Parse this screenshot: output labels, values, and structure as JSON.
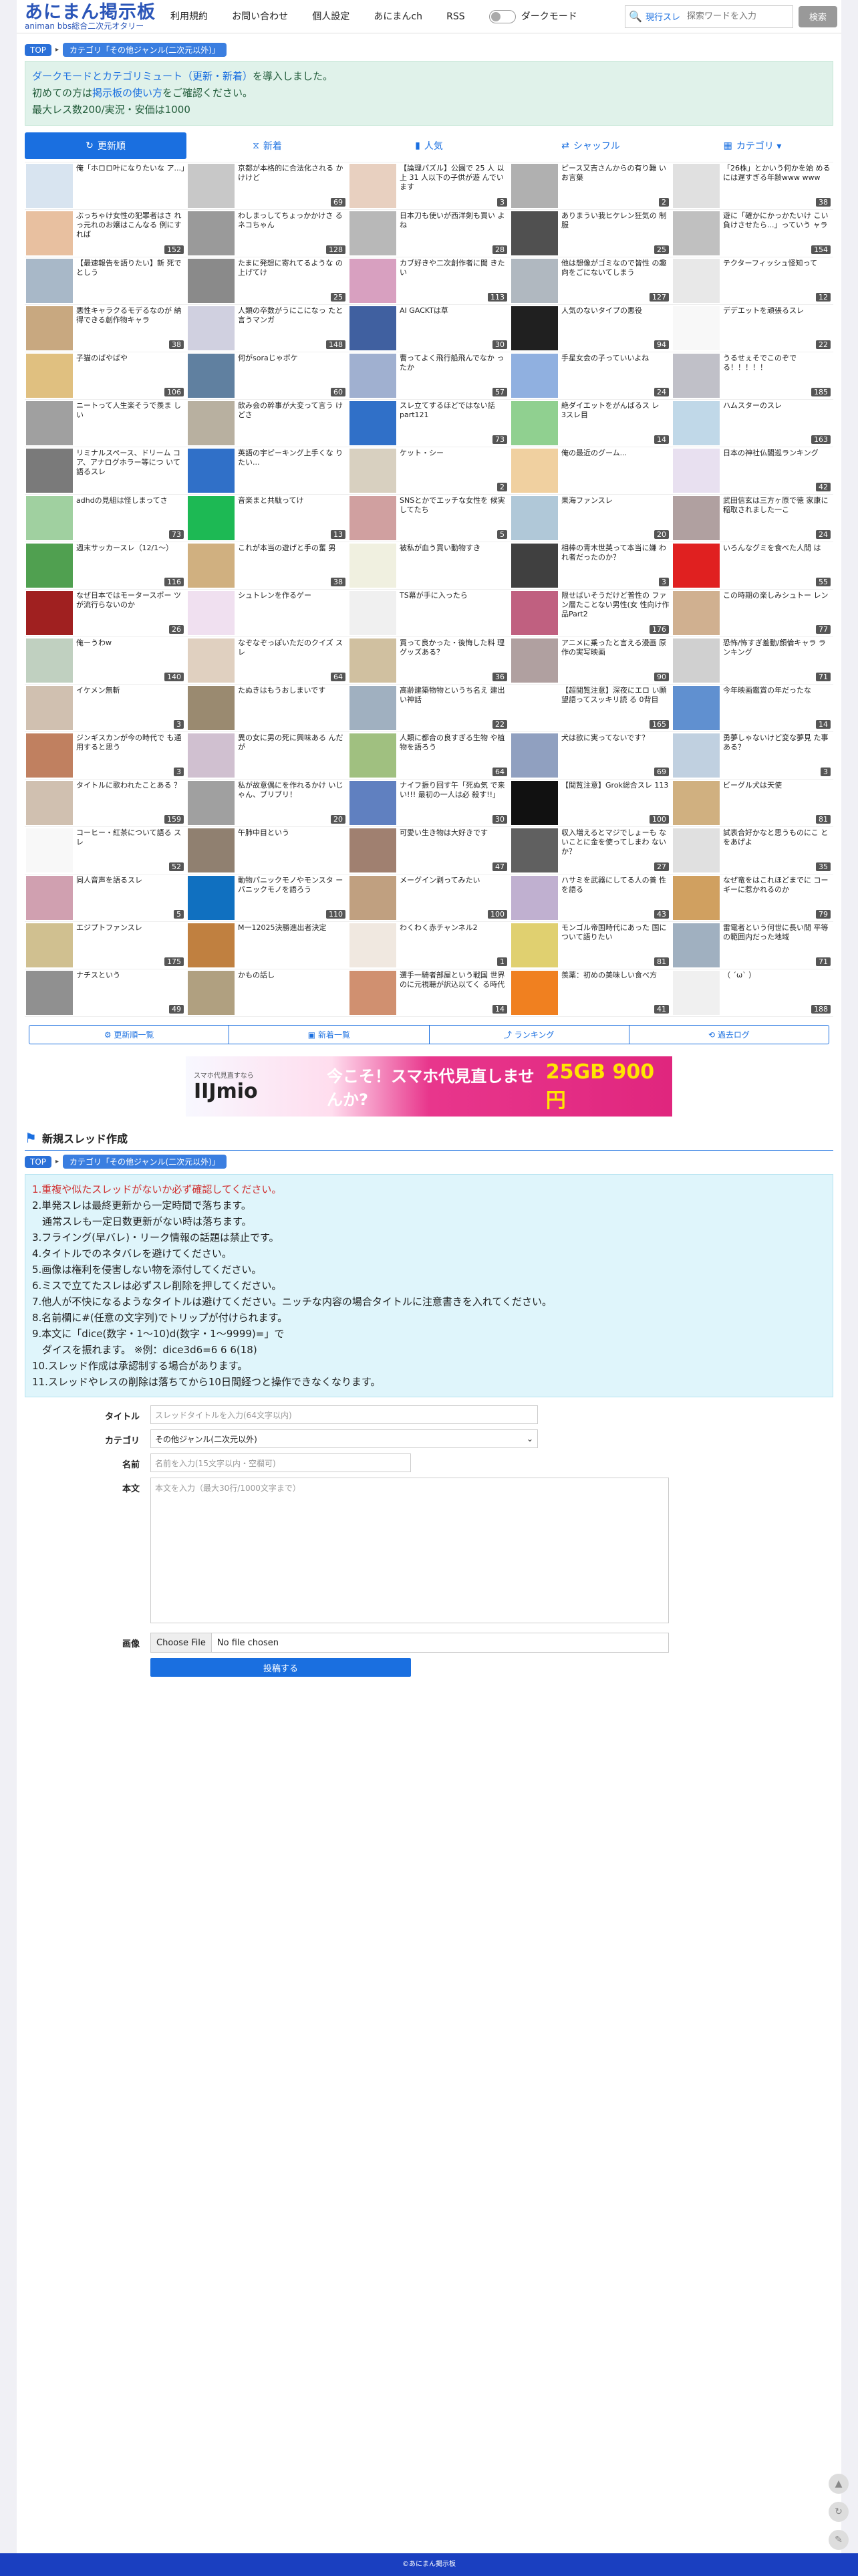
{
  "header": {
    "logo_title": "あにまん掲示板",
    "logo_sub": "animan bbs総合二次元オタリー",
    "nav": [
      "利用規約",
      "お問い合わせ",
      "個人設定",
      "あにまんch",
      "RSS"
    ],
    "dark_mode": "ダークモード",
    "search_scope": "現行スレ",
    "search_placeholder": "探索ワードを入力",
    "search_button": "検索"
  },
  "breadcrumb": {
    "top": "TOP",
    "category": "カテゴリ「その他ジャンル(二次元以外)」"
  },
  "notice": {
    "line1_link": "ダークモードとカテゴリミュート（更新・新着）",
    "line1_rest": "を導入しました。",
    "line2_pre": "初めての方は",
    "line2_link": "掲示板の使い方",
    "line2_post": "をご確認ください。",
    "line3": "最大レス数200/実況・安価は1000"
  },
  "tabs": [
    {
      "icon": "↻",
      "label": "更新順"
    },
    {
      "icon": "⧖",
      "label": "新着"
    },
    {
      "icon": "▮",
      "label": "人気"
    },
    {
      "icon": "⇄",
      "label": "シャッフル"
    },
    {
      "icon": "▦",
      "label": "カテゴリ ▾"
    }
  ],
  "threads": [
    {
      "t": "俺「ホロロ叶になりたいな ア...」",
      "c": "",
      "col": "#d8e4f0"
    },
    {
      "t": "京都が本格的に合法化される かけけど",
      "c": "69",
      "col": "#c8c8c8"
    },
    {
      "t": "【論理パズル】公園で 25 人 以上 31 人以下の子供が遊 んでいます",
      "c": "3",
      "col": "#e8d0c0"
    },
    {
      "t": "ピース又吉さんからの有り難 いお言葉",
      "c": "2",
      "col": "#b0b0b0"
    },
    {
      "t": "「26株」とかいう何かを始 めるには遅すぎる年齢www www",
      "c": "38",
      "col": "#e0e0e0"
    },
    {
      "t": "ぶっちゃけ女性の犯罪者はさ れっ元れのお嬢はこんなる 例にすれば",
      "c": "152",
      "col": "#e8c0a0"
    },
    {
      "t": "わしまっしてちょっかかけさ るネコちゃん",
      "c": "128",
      "col": "#9a9a9a"
    },
    {
      "t": "日本刀も使いが西洋剣も買い よね",
      "c": "28",
      "col": "#b8b8b8"
    },
    {
      "t": "ありまうい我ヒケレン狂気の 制服",
      "c": "25",
      "col": "#505050"
    },
    {
      "t": "遊に「確かにかっかたいけ こい負けさせたら...」っていう ャラ",
      "c": "154",
      "col": "#c0c0c0"
    },
    {
      "t": "【最速報告を語りたい】新 死でとしう",
      "c": "",
      "col": "#a8b8c8"
    },
    {
      "t": "たまに発想に寄れてるような の上げてけ",
      "c": "25",
      "col": "#8a8a8a"
    },
    {
      "t": "カブ好きや二次創作者に聞 きたい",
      "c": "113",
      "col": "#d8a0c0"
    },
    {
      "t": "他は想像がゴミなので皆性 の趣向をごにないてしまう",
      "c": "127",
      "col": "#b0b8c0"
    },
    {
      "t": "テクターフィッシュ怪知って",
      "c": "12",
      "col": "#e8e8e8"
    },
    {
      "t": "悪性キャラクるモデるなのが 納得できる創作物キャラ",
      "c": "38",
      "col": "#c8a880"
    },
    {
      "t": "人類の卒数がうにこになっ たと言うマンガ",
      "c": "148",
      "col": "#d0d0e0"
    },
    {
      "t": "AI GACKTは草",
      "c": "30",
      "col": "#4060a0"
    },
    {
      "t": "人気のないタイプの悪役",
      "c": "94",
      "col": "#202020"
    },
    {
      "t": "デデエットを頑張るスレ",
      "c": "22",
      "col": "#f8f8f8"
    },
    {
      "t": "子猫のばやばや",
      "c": "106",
      "col": "#e0c080"
    },
    {
      "t": "何がsoraじゃボケ",
      "c": "60",
      "col": "#6080a0"
    },
    {
      "t": "曹ってよく飛行船飛んでなか ったか",
      "c": "57",
      "col": "#a0b0d0"
    },
    {
      "t": "手星女会の子っていいよね",
      "c": "24",
      "col": "#90b0e0"
    },
    {
      "t": "うるせぇそでこのぞで る！！！！！",
      "c": "185",
      "col": "#c0c0c8"
    },
    {
      "t": "ニートって人生楽そうで羨ま しい",
      "c": "",
      "col": "#a0a0a0"
    },
    {
      "t": "飲み会の幹事が大変って言う けどさ",
      "c": "",
      "col": "#b8b0a0"
    },
    {
      "t": "スレ立てするほどではない話 part121",
      "c": "73",
      "col": "#3070c8"
    },
    {
      "t": "絶ダイエットをがんばるス レ　3スレ目",
      "c": "14",
      "col": "#90d090"
    },
    {
      "t": "ハムスターのスレ",
      "c": "163",
      "col": "#c0d8e8"
    },
    {
      "t": "リミナルスペース、ドリーム コア、アナログホラー等につ いて語るスレ",
      "c": "",
      "col": "#7a7a7a"
    },
    {
      "t": "英語の宇ピーキング上手くな りたい...",
      "c": "",
      "col": "#3070c8"
    },
    {
      "t": "ケット・シー",
      "c": "2",
      "col": "#d8d0c0"
    },
    {
      "t": "俺の最近のグーム...",
      "c": "",
      "col": "#f0d0a0"
    },
    {
      "t": "日本の神社仏閣巡ランキング",
      "c": "42",
      "col": "#e8e0f0"
    },
    {
      "t": "adhdの見組は怪しまってさ",
      "c": "73",
      "col": "#a0d0a0"
    },
    {
      "t": "音楽まと共駄ってけ",
      "c": "13",
      "col": "#1db954"
    },
    {
      "t": "SNSとかでエッチな女性を 候実してたち",
      "c": "5",
      "col": "#d0a0a0"
    },
    {
      "t": "果海ファンスレ",
      "c": "20",
      "col": "#b0c8d8"
    },
    {
      "t": "武田信玄は三方ヶ原で徳 家康に稲取されました一こ",
      "c": "24",
      "col": "#b0a0a0"
    },
    {
      "t": "週末サッカースレ（12/1〜）",
      "c": "116",
      "col": "#50a050"
    },
    {
      "t": "これが本当の遊げと手の奮 男",
      "c": "38",
      "col": "#d0b080"
    },
    {
      "t": "被私が血う買い動物すき",
      "c": "",
      "col": "#f0f0e0"
    },
    {
      "t": "相棒の青木世英って本当に嫌 われ者だったのか？",
      "c": "3",
      "col": "#404040"
    },
    {
      "t": "いろんなグミを食べた人間 は",
      "c": "55",
      "col": "#e02020"
    },
    {
      "t": "なぜ日本ではモータースポー ツが流行らないのか",
      "c": "26",
      "col": "#a02020"
    },
    {
      "t": "シュトレンを作るゲー",
      "c": "",
      "col": "#f0e0f0"
    },
    {
      "t": "TS幕が手に入ったら",
      "c": "",
      "col": "#f0f0f0"
    },
    {
      "t": "限せばいそうだけど普性の ファン層たことない男性(女 性向け作品Part2",
      "c": "176",
      "col": "#c06080"
    },
    {
      "t": "この時期の楽しみシュトー レン",
      "c": "77",
      "col": "#d0b090"
    },
    {
      "t": "俺ーうわw",
      "c": "140",
      "col": "#c0d0c0"
    },
    {
      "t": "なぞなぞっぽいただのクイズ スレ",
      "c": "64",
      "col": "#e0d0c0"
    },
    {
      "t": "買って良かった・後悔した料 理グッズある？",
      "c": "36",
      "col": "#d0c0a0"
    },
    {
      "t": "アニメに乗ったと言える漫画 原作の実写映画",
      "c": "90",
      "col": "#b0a0a0"
    },
    {
      "t": "恐怖/怖すぎ羞動/顔倫キャラ ランキング",
      "c": "71",
      "col": "#d0d0d0"
    },
    {
      "t": "イケメン無斬",
      "c": "3",
      "col": "#d0c0b0"
    },
    {
      "t": "たぬきはもうおしまいです",
      "c": "",
      "col": "#9a8a70"
    },
    {
      "t": "高齢建築物物というち名え 建出い神話",
      "c": "22",
      "col": "#a0b0c0"
    },
    {
      "t": "【超閲覧注意】深夜にエロ い願望語ってスッキリ読 る 0背目",
      "c": "165",
      "col": "#ffffff"
    },
    {
      "t": "今年映画鑑賞の年だったな",
      "c": "14",
      "col": "#6090d0"
    },
    {
      "t": "ジンギスカンが今の時代で も通用すると思う",
      "c": "3",
      "col": "#c08060"
    },
    {
      "t": "異の女に男の死に興味ある んだが",
      "c": "",
      "col": "#d0c0d0"
    },
    {
      "t": "人類に都合の良すぎる生物 や植物を語ろう",
      "c": "64",
      "col": "#a0c080"
    },
    {
      "t": "犬は欲に実ってないです？",
      "c": "69",
      "col": "#90a0c0"
    },
    {
      "t": "勇夢しゃないけど変な夢見 た事ある？",
      "c": "3",
      "col": "#c0d0e0"
    },
    {
      "t": "タイトルに歌われたことある ？",
      "c": "159",
      "col": "#d0c0b0"
    },
    {
      "t": "私が故意偶にを作れるかけ いじゃん、ブリブリ！",
      "c": "20",
      "col": "#a0a0a0"
    },
    {
      "t": "ナイフ振り回す午「死ぬ気 で来い!!! 最初の一人は必 殺す!!」",
      "c": "30",
      "col": "#6080c0"
    },
    {
      "t": "【閲覧注意】Grok総合スレ 113",
      "c": "100",
      "col": "#111111"
    },
    {
      "t": "ビーグル犬は天使",
      "c": "81",
      "col": "#d0b080"
    },
    {
      "t": "コーヒー・紅茶について語る スレ",
      "c": "52",
      "col": "#f8f8f8"
    },
    {
      "t": "午肺中目という",
      "c": "",
      "col": "#908070"
    },
    {
      "t": "可愛い生き物は大好きです",
      "c": "47",
      "col": "#a08070"
    },
    {
      "t": "収入増えるとマジでしょーも ないことに金を使ってしまわ ないか？",
      "c": "27",
      "col": "#606060"
    },
    {
      "t": "試表合好かなと思うものにこ とをあげよ",
      "c": "35",
      "col": "#e0e0e0"
    },
    {
      "t": "同人音声を語るスレ",
      "c": "5",
      "col": "#d0a0b0"
    },
    {
      "t": "動物パニックモノやモンスタ ーパニックモノを語ろう",
      "c": "110",
      "col": "#1070c0"
    },
    {
      "t": "メーグイン剥ってみたい",
      "c": "100",
      "col": "#c0a080"
    },
    {
      "t": "ハサミを武器にしてる人の善 性を語る",
      "c": "43",
      "col": "#c0b0d0"
    },
    {
      "t": "なぜ竜をはこれほどまでに コーギーに惹かれるのか",
      "c": "79",
      "col": "#d0a060"
    },
    {
      "t": "エジプトファンスレ",
      "c": "175",
      "col": "#d0c090"
    },
    {
      "t": "M一12025決勝進出者決定",
      "c": "",
      "col": "#c08040"
    },
    {
      "t": "わくわく赤チャンネル2",
      "c": "1",
      "col": "#f0e8e0"
    },
    {
      "t": "モンゴル帝国時代にあった 国について語りたい",
      "c": "81",
      "col": "#e0d070"
    },
    {
      "t": "雷電者という何世に長い間 平等の範囲内だった地域",
      "c": "71",
      "col": "#a0b0c0"
    },
    {
      "t": "ナチスという",
      "c": "49",
      "col": "#909090"
    },
    {
      "t": "かもの話し",
      "c": "",
      "col": "#b0a080"
    },
    {
      "t": "選手一騎者部屋という戦国 世界のに元視聴が訳込以てく る時代",
      "c": "14",
      "col": "#d09070"
    },
    {
      "t": "羨薬：初めの美味しい食べ方",
      "c": "41",
      "col": "#f08020"
    },
    {
      "t": "（ ´ω` ）",
      "c": "188",
      "col": "#f0f0f0"
    }
  ],
  "subnav": [
    {
      "icon": "⚙",
      "label": "更新順一覧"
    },
    {
      "icon": "▣",
      "label": "新着一覧"
    },
    {
      "icon": "⤴",
      "label": "ランキング"
    },
    {
      "icon": "⟲",
      "label": "過去ログ"
    }
  ],
  "ad": {
    "small": "スマホ代見直すなら",
    "brand": "IIJmio",
    "headline": "今こそ！スマホ代見直しませんか?",
    "price": "25GB 900円"
  },
  "new_thread": {
    "title": "新規スレッド作成",
    "rules": [
      "1.重複や似たスレッドがないか必ず確認してください。",
      "2.単発スレは最終更新から一定時間で落ちます。",
      "　通常スレも一定日数更新がない時は落ちます。",
      "3.フライング(早バレ)・リーク情報の話題は禁止です。",
      "4.タイトルでのネタバレを避けてください。",
      "5.画像は権利を侵害しない物を添付してください。",
      "6.ミスで立てたスレは必ずスレ削除を押してください。",
      "7.他人が不快になるようなタイトルは避けてください。ニッチな内容の場合タイトルに注意書きを入れてください。",
      "8.名前欄に#(任意の文字列)でトリップが付けられます。",
      "9.本文に「dice(数字・1〜10)d(数字・1〜9999)=」で",
      "　ダイスを振れます。 ※例：dice3d6=6 6 6(18)",
      "10.スレッド作成は承認制する場合があります。",
      "11.スレッドやレスの削除は落ちてから10日間経つと操作できなくなります。"
    ],
    "labels": {
      "title": "タイトル",
      "category": "カテゴリ",
      "name": "名前",
      "body": "本文",
      "image": "画像"
    },
    "title_placeholder": "スレッドタイトルを入力(64文字以内)",
    "category_value": "その他ジャンル(二次元以外)",
    "name_placeholder": "名前を入力(15文字以内・空欄可)",
    "body_placeholder": "本文を入力（最大30行/1000文字まで）",
    "file_button": "Choose File",
    "file_status": "No file chosen",
    "submit": "投稿する"
  },
  "footer": "©あにまん掲示板",
  "colors": {
    "accent": "#1a6fe0",
    "notice_bg": "#e0f2ea",
    "rules_bg": "#dff5fb",
    "footer_bg": "#1a3fc0"
  }
}
